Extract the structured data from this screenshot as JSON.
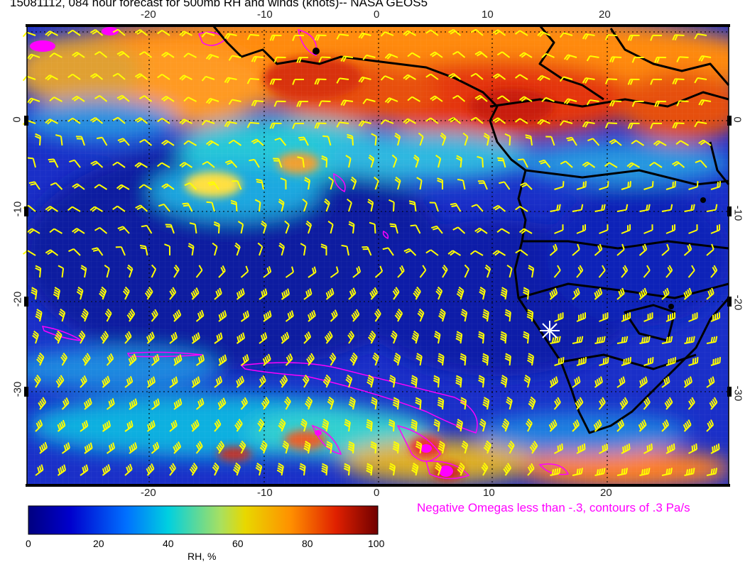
{
  "title": "15081112, 084 hour forecast for 500mb RH and winds (knots)-- NASA GEOS5",
  "x_ticks": [
    "-20",
    "-10",
    "0",
    "10",
    "20"
  ],
  "y_ticks": [
    "0",
    "-10",
    "-20",
    "-30"
  ],
  "omega_note": "Negative Omegas less than -.3, contours of .3 Pa/s",
  "colorbar": {
    "label": "RH, %",
    "ticks": [
      "0",
      "20",
      "40",
      "60",
      "80",
      "100"
    ]
  },
  "colors": {
    "barb": "#ffff00",
    "omega": "#ff00ff",
    "coast": "#000000",
    "marker": "#ffffff"
  },
  "icons": {
    "marker": "white-star-marker"
  }
}
